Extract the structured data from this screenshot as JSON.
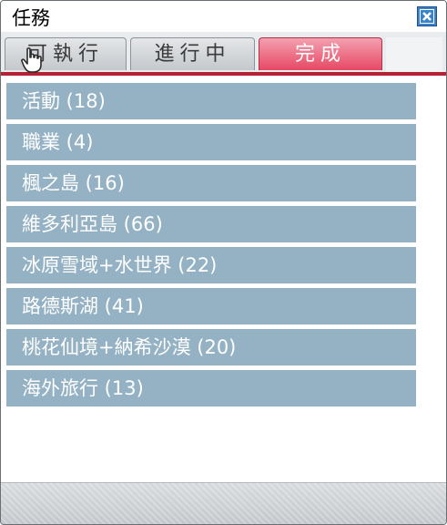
{
  "window": {
    "title": "任務"
  },
  "tabs": [
    {
      "label": "可執行",
      "active": false
    },
    {
      "label": "進行中",
      "active": false
    },
    {
      "label": "完成",
      "active": true
    }
  ],
  "categories": [
    {
      "label": "活動 (18)"
    },
    {
      "label": "職業 (4)"
    },
    {
      "label": "楓之島 (16)"
    },
    {
      "label": "維多利亞島 (66)"
    },
    {
      "label": "冰原雪域+水世界 (22)"
    },
    {
      "label": "路德斯湖 (41)"
    },
    {
      "label": "桃花仙境+納希沙漠 (20)"
    },
    {
      "label": "海外旅行 (13)"
    }
  ],
  "colors": {
    "active_tab": "#e64863",
    "accent_line": "#b52233",
    "list_item_bg": "#94b2c4",
    "close_button": "#3b83c9"
  },
  "icons": {
    "close": "close-icon",
    "cursor": "hand-pointer-icon"
  }
}
